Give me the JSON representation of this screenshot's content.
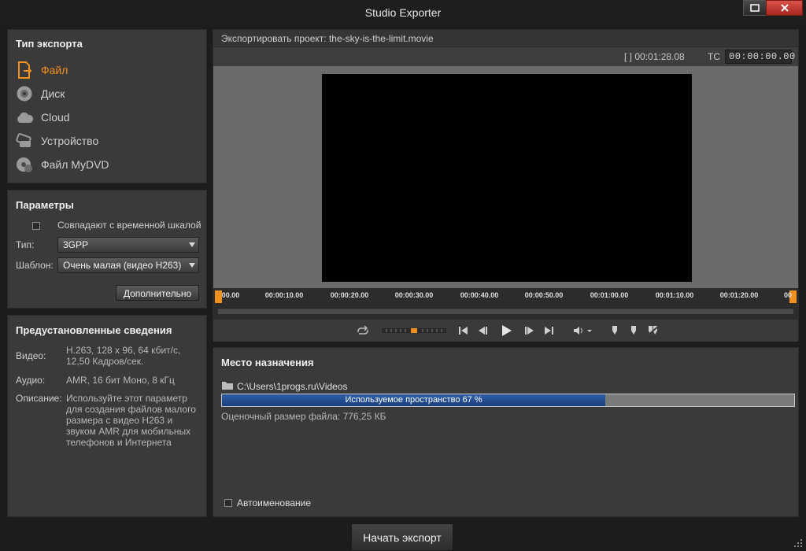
{
  "window": {
    "title": "Studio Exporter"
  },
  "export_type": {
    "title": "Тип экспорта",
    "items": [
      {
        "label": "Файл",
        "icon": "file-export-icon",
        "active": true
      },
      {
        "label": "Диск",
        "icon": "disc-icon",
        "active": false
      },
      {
        "label": "Cloud",
        "icon": "cloud-icon",
        "active": false
      },
      {
        "label": "Устройство",
        "icon": "device-icon",
        "active": false
      },
      {
        "label": "Файл MyDVD",
        "icon": "mydvd-icon",
        "active": false
      }
    ]
  },
  "params": {
    "title": "Параметры",
    "match_timeline_label": "Совпадают с временной шкалой",
    "type_label": "Тип:",
    "type_value": "3GPP",
    "template_label": "Шаблон:",
    "template_value": "Очень малая (видео H263)",
    "advanced_button": "Дополнительно"
  },
  "preset": {
    "title": "Предустановленные сведения",
    "video_label": "Видео:",
    "video_value": "H.263, 128 x 96, 64 кбит/с, 12,50 Кадров/сек.",
    "audio_label": "Аудио:",
    "audio_value": "AMR, 16 бит Моно, 8 кГц",
    "desc_label": "Описание:",
    "desc_value": "Используйте этот параметр для создания файлов малого размера с видео H263 и звуком AMR для мобильных телефонов и Интернета"
  },
  "preview": {
    "project_label": "Экспортировать проект: the-sky-is-the-limit.movie",
    "duration": "[ ] 00:01:28.08",
    "tc_label": "TC",
    "tc_value": "00:00:00.00",
    "ticks": [
      "00.00",
      "00:00:10.00",
      "00:00:20.00",
      "00:00:30.00",
      "00:00:40.00",
      "00:00:50.00",
      "00:01:00.00",
      "00:01:10.00",
      "00:01:20.00",
      "00"
    ]
  },
  "destination": {
    "title": "Место назначения",
    "path": "C:\\Users\\1progs.ru\\Videos",
    "space_text": "Используемое пространство 67 %",
    "space_used": 0.67,
    "est_size": "Оценочный размер файла: 776,25 КБ",
    "auto_naming": "Автоименование"
  },
  "footer": {
    "start_button": "Начать экспорт"
  },
  "colors": {
    "accent": "#f39020",
    "progress": "#2e5ea8",
    "panel": "#3a3a3a"
  }
}
